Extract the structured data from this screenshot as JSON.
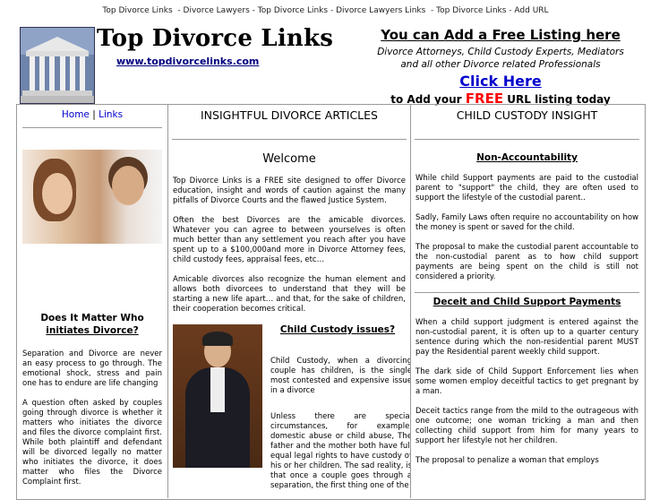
{
  "topnav": [
    "Top Divorce Links",
    "Divorce Lawyers",
    "Top Divorce Links",
    "Divorce Lawyers Links",
    "Top Divorce Links",
    "Add URL"
  ],
  "header": {
    "title": "Top Divorce Links",
    "url": "www.topdivorcelinks.com"
  },
  "ad": {
    "headline": "You can Add a Free Listing here",
    "line1": "Divorce Attorneys, Child Custody Experts, Mediators",
    "line2": "and all other Divorce related Professionals",
    "click": "Click Here",
    "url_pre": "to Add your",
    "url_free": "FREE",
    "url_post": "URL listing today"
  },
  "left": {
    "home": "Home",
    "sep": "|",
    "links": "Links",
    "heading1": "Does It Matter Who",
    "heading2": "initiates Divorce?",
    "p1": "Separation and Divorce are never an easy process to go through. The emotional shock, stress and pain one has to endure are life changing",
    "p2": "A question often asked by couples going through divorce is whether it matters who initiates the divorce and files the divorce complaint first. While both plaintiff and defendant will be divorced legally no matter who initiates the divorce, it does matter who files the Divorce Complaint first."
  },
  "middle": {
    "heading": "INSIGHTFUL DIVORCE ARTICLES",
    "welcome": "Welcome",
    "p1": "Top Divorce Links  is a FREE site designed to offer Divorce education, insight and words of caution against the many pitfalls of Divorce Courts and the flawed Justice System.",
    "p2": "Often the best Divorces are the amicable divorces. Whatever you can agree to between yourselves is often much better than any settlement you reach after you have spent up to a $100,000and more in Divorce Attorney fees, child custody fees, appraisal fees, etc…",
    "p3": "Amicable divorces also recognize the human element and allows both divorcees to understand that they will be starting a new life apart… and that, for the sake of children, their cooperation becomes critical.",
    "cc_title": "Child Custody issues?",
    "cc_p1": "Child Custody, when a divorcing couple has children, is the single most contested and expensive issue in a divorce",
    "cc_p2": "Unless there are special circumstances, for example, domestic abuse or child abuse, The father and the mother both have full equal legal rights to have custody of his or her children.  The sad reality, is that once a couple goes through a separation, the first thing one of the"
  },
  "right": {
    "heading": "CHILD CUSTODY INSIGHT",
    "s1_title": "Non-Accountability",
    "s1_p1": "While child Support payments are paid to the custodial parent to \"support\" the child, they are often used to support the lifestyle of the custodial parent..",
    "s1_p2": "Sadly, Family Laws often require no accountability on how the money is spent or saved for the child.",
    "s1_p3": "The proposal to make the custodial parent accountable to the non-custodial parent  as to how child support payments are being spent on the child is still not considered a priority.",
    "s2_title": "Deceit and Child Support Payments",
    "s2_p1": "When a child support judgment is entered against the non-custodial parent, it is often up to a quarter century sentence during which the non-residential parent MUST pay the Residential parent weekly child support.",
    "s2_p2": "The dark side of Child Support Enforcement lies when some women employ deceitful tactics to get pregnant by a man.",
    "s2_p3": "Deceit tactics range from the mild to the outrageous with one outcome; one woman tricking a man and then collecting child support from him for many years to support her lifestyle not her children.",
    "s2_p4": "The proposal to penalize a woman that employs"
  }
}
